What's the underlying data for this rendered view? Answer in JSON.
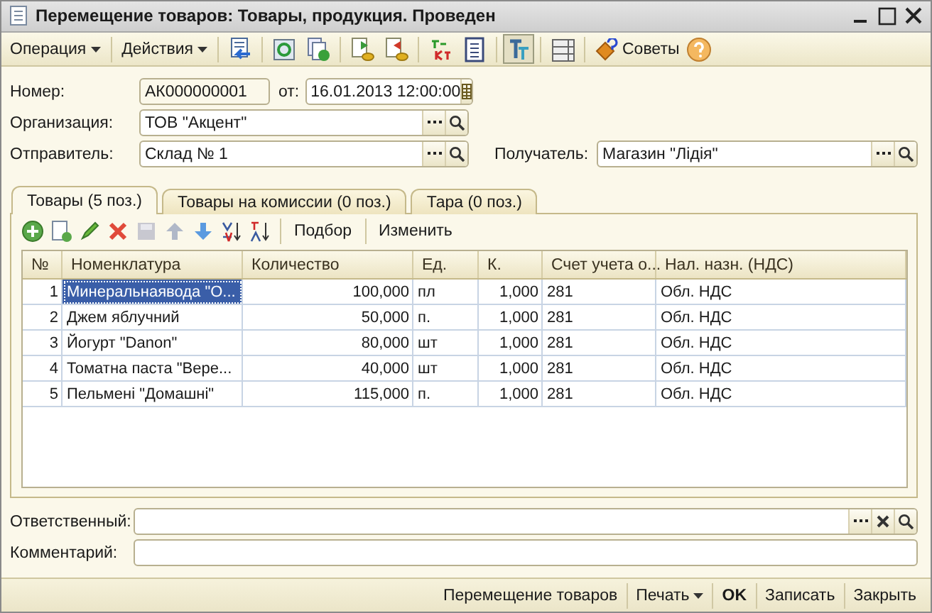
{
  "window": {
    "title": "Перемещение товаров: Товары, продукция. Проведен"
  },
  "toolbar": {
    "menus": [
      "Операция",
      "Действия"
    ],
    "tools": [
      {
        "pressed": false
      },
      {
        "pressed": false
      },
      {
        "pressed": false
      },
      {
        "pressed": false
      },
      {
        "pressed": false
      },
      {
        "pressed": false
      },
      {
        "pressed": false
      },
      {
        "pressed": true
      },
      {
        "pressed": false
      }
    ],
    "tips": "Советы"
  },
  "header": {
    "number_label": "Номер:",
    "number": "АК000000001",
    "date_label": "от:",
    "date": "16.01.2013 12:00:00",
    "organization_label": "Организация:",
    "organization": "ТОВ \"Акцент\"",
    "sender_label": "Отправитель:",
    "sender": "Склад № 1",
    "receiver_label": "Получатель:",
    "receiver": "Магазин \"Лідія\""
  },
  "tabs": [
    {
      "label": "Товары (5 поз.)",
      "selected": true
    },
    {
      "label": "Товары на комиссии (0 поз.)",
      "selected": false
    },
    {
      "label": "Тара (0 поз.)",
      "selected": false
    }
  ],
  "table_toolbar": {
    "buttons": [
      "Подбор",
      "Изменить"
    ]
  },
  "table": {
    "columns": [
      "№",
      "Номенклатура",
      "Количество",
      "Ед.",
      "К.",
      "Счет учета о...",
      "Нал. назн. (НДС)"
    ],
    "rows": [
      {
        "cells": [
          "1",
          "Минеральнаявода \"О...",
          "100,000",
          "пл",
          "1,000",
          "281",
          "Обл. НДС"
        ],
        "selected": true
      },
      {
        "cells": [
          "2",
          "Джем яблучний",
          "50,000",
          "п.",
          "1,000",
          "281",
          "Обл. НДС"
        ],
        "selected": false
      },
      {
        "cells": [
          "3",
          "Йогурт \"Danon\"",
          "80,000",
          "шт",
          "1,000",
          "281",
          "Обл. НДС"
        ],
        "selected": false
      },
      {
        "cells": [
          "4",
          "Томатна паста \"Вере...",
          "40,000",
          "шт",
          "1,000",
          "281",
          "Обл. НДС"
        ],
        "selected": false
      },
      {
        "cells": [
          "5",
          "Пельмені \"Домашні\"",
          "115,000",
          "п.",
          "1,000",
          "281",
          "Обл. НДС"
        ],
        "selected": false
      }
    ]
  },
  "footer_fields": {
    "responsible_label": "Ответственный:",
    "comment_label": "Комментарий:"
  },
  "status_bar": {
    "buttons": [
      {
        "label": "Перемещение товаров",
        "kind": "plain"
      },
      {
        "label": "Печать",
        "kind": "menu"
      },
      {
        "label": "OK",
        "kind": "bold"
      },
      {
        "label": "Записать",
        "kind": "plain"
      },
      {
        "label": "Закрыть",
        "kind": "plain"
      }
    ]
  }
}
